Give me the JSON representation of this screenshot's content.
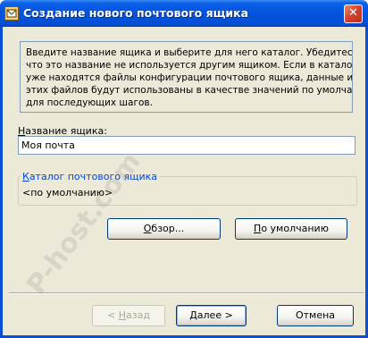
{
  "window": {
    "title": "Создание нового почтового ящика",
    "close_glyph": "✕",
    "title_icon": "mailbox-wizard-icon",
    "accent_color": "#0a4fd6"
  },
  "info": {
    "lines": [
      "Введите название ящика и выберите для него каталог. Убедитесь,",
      "что это название не используется другим ящиком. Если в каталоге",
      "уже находятся файлы конфигурации почтового ящика, данные из",
      "этих файлов будут использованы в качестве значений по умолчанию",
      "для последующих шагов."
    ]
  },
  "name_field": {
    "label": "Название ящика:",
    "value": "Моя почта"
  },
  "folder": {
    "legend": "Каталог почтового ящика",
    "value": "<по умолчанию>"
  },
  "buttons": {
    "browse": {
      "prefix": "",
      "mnemonic": "О",
      "rest": "бзор..."
    },
    "default": {
      "prefix": "",
      "mnemonic": "П",
      "rest": "о умолчанию"
    },
    "back": {
      "prefix": "< ",
      "mnemonic": "Н",
      "rest": "азад"
    },
    "next": {
      "prefix": "",
      "mnemonic": "Д",
      "rest": "алее >"
    },
    "cancel": {
      "label": "Отмена"
    }
  },
  "watermark": "P-host.com"
}
